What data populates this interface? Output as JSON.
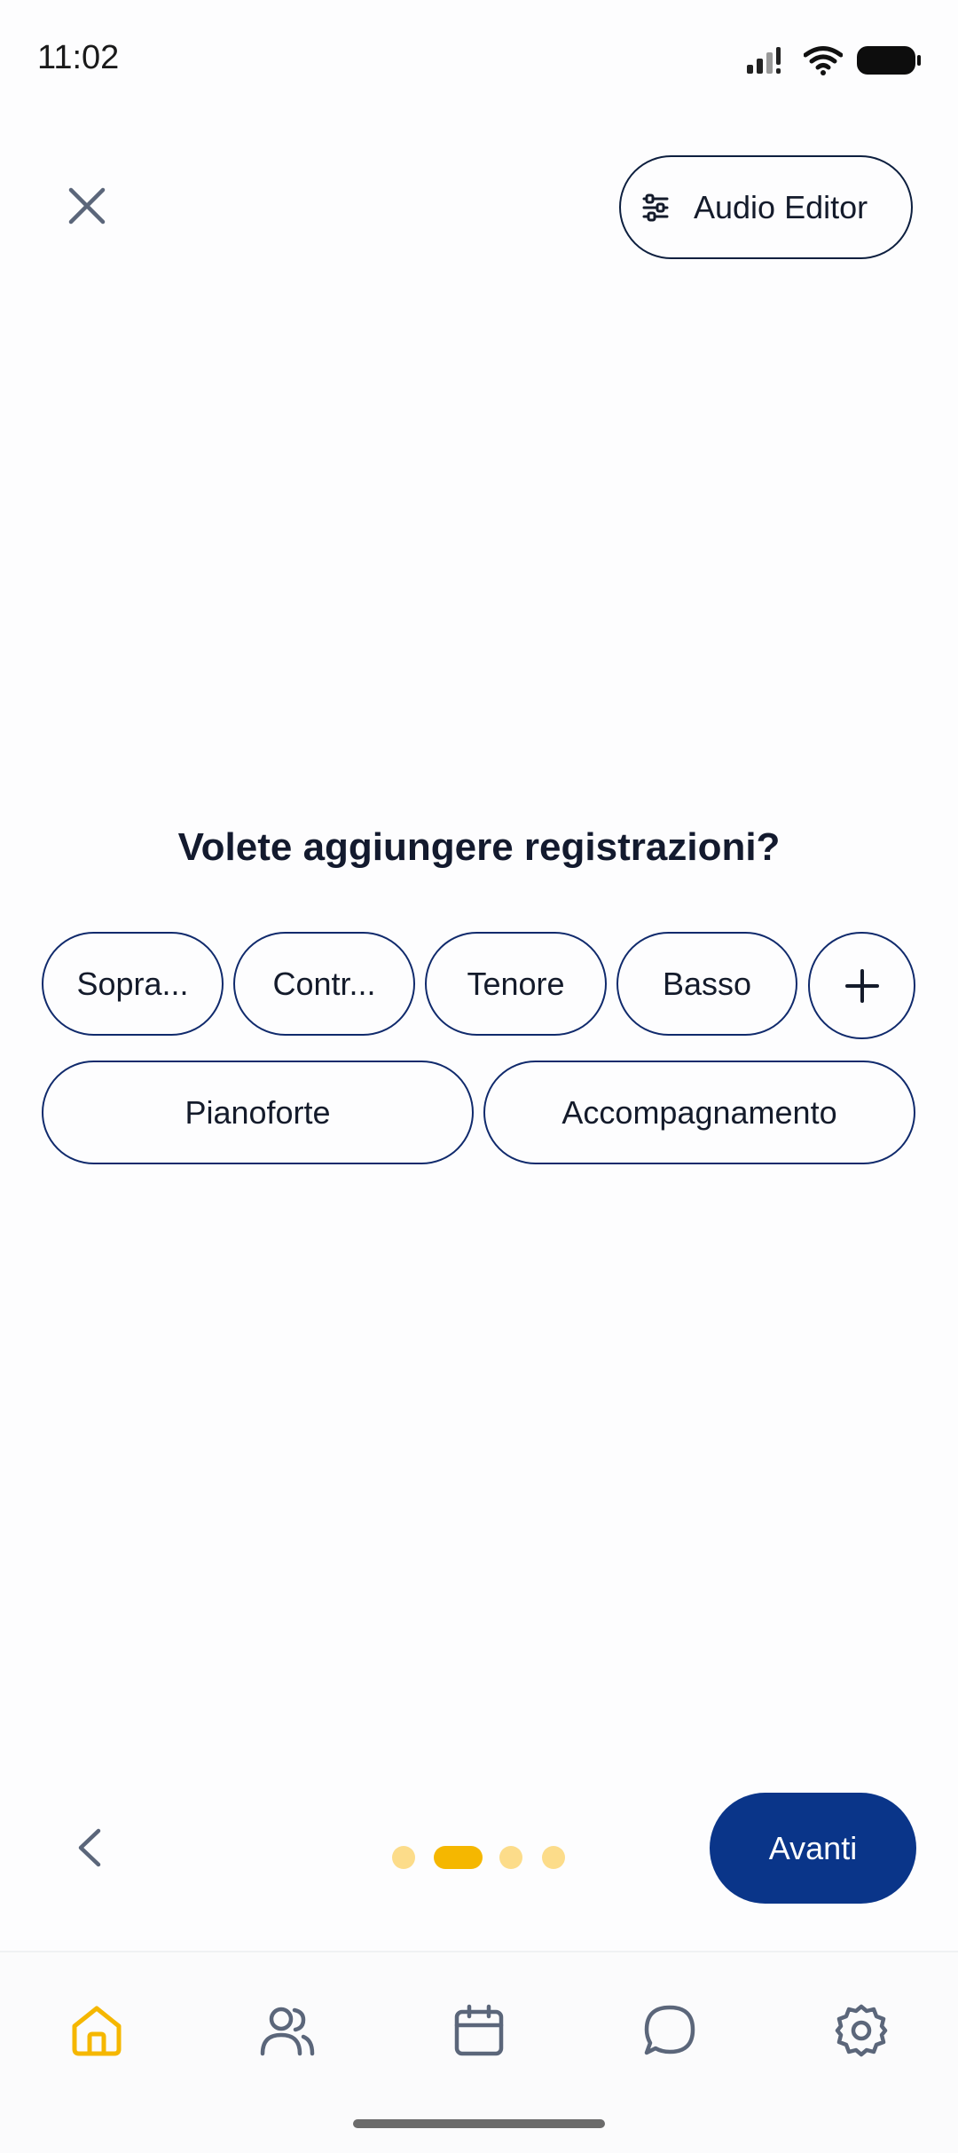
{
  "status_bar": {
    "time": "11:02"
  },
  "header": {
    "audio_editor_label": "Audio Editor"
  },
  "main": {
    "question": "Volete aggiungere registrazioni?",
    "chips_row1": [
      "Sopra...",
      "Contr...",
      "Tenore",
      "Basso"
    ],
    "add_chip_label": "+",
    "chips_row2": [
      "Pianoforte",
      "Accompagnamento"
    ]
  },
  "footer": {
    "next_label": "Avanti",
    "pager": {
      "total": 4,
      "active_index": 1
    }
  },
  "nav": {
    "items": [
      "home-icon",
      "users-icon",
      "calendar-icon",
      "chat-icon",
      "gear-icon"
    ],
    "active": "home-icon"
  },
  "colors": {
    "accent_yellow": "#f5b700",
    "primary_blue": "#0a3589",
    "icon_gray": "#5b667a"
  }
}
